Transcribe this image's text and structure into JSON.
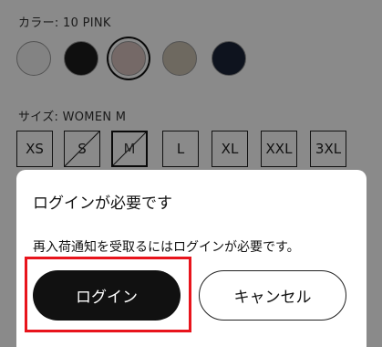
{
  "color": {
    "label": "カラー: 10 PINK",
    "swatches": [
      {
        "name": "white",
        "color": "#f2f2f2",
        "selected": false
      },
      {
        "name": "black",
        "color": "#1c1c1c",
        "selected": false
      },
      {
        "name": "pink",
        "color": "#d9c2bf",
        "selected": true
      },
      {
        "name": "beige",
        "color": "#cbc2b2",
        "selected": false
      },
      {
        "name": "navy",
        "color": "#1a2438",
        "selected": false
      }
    ]
  },
  "size": {
    "label": "サイズ: WOMEN M",
    "options": [
      {
        "label": "XS",
        "unavailable": false,
        "selected": false
      },
      {
        "label": "S",
        "unavailable": true,
        "selected": false
      },
      {
        "label": "M",
        "unavailable": true,
        "selected": true
      },
      {
        "label": "L",
        "unavailable": false,
        "selected": false
      },
      {
        "label": "XL",
        "unavailable": false,
        "selected": false
      },
      {
        "label": "XXL",
        "unavailable": false,
        "selected": false
      },
      {
        "label": "3XL",
        "unavailable": false,
        "selected": false
      }
    ]
  },
  "modal": {
    "title": "ログインが必要です",
    "message": "再入荷通知を受取るにはログインが必要です。",
    "login_label": "ログイン",
    "cancel_label": "キャンセル"
  },
  "colors": {
    "overlay": "rgba(0,0,0,0.46)",
    "highlight": "#e8141c",
    "primary_button": "#111111"
  }
}
